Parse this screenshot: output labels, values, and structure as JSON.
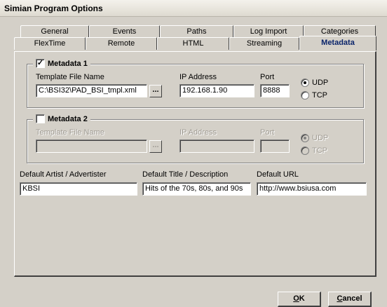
{
  "window": {
    "title": "Simian Program Options"
  },
  "tabs": {
    "row1": [
      "General",
      "Events",
      "Paths",
      "Log Import",
      "Categories"
    ],
    "row2": [
      "FlexTime",
      "Remote",
      "HTML",
      "Streaming",
      "Metadata"
    ],
    "active": "Metadata"
  },
  "metadata1": {
    "label": "Metadata 1",
    "checked": true,
    "check_glyph": "✓",
    "template_label": "Template File Name",
    "template_value": "C:\\BSI32\\PAD_BSI_tmpl.xml",
    "browse_label": "...",
    "ip_label": "IP Address",
    "ip_value": "192.168.1.90",
    "port_label": "Port",
    "port_value": "8888",
    "protocol_options": [
      "UDP",
      "TCP"
    ],
    "protocol_selected": "UDP"
  },
  "metadata2": {
    "label": "Metadata 2",
    "checked": false,
    "template_label": "Template File Name",
    "template_value": "",
    "browse_label": "...",
    "ip_label": "IP Address",
    "ip_value": "",
    "port_label": "Port",
    "port_value": "",
    "protocol_options": [
      "UDP",
      "TCP"
    ],
    "protocol_selected": "UDP"
  },
  "defaults": {
    "artist_label": "Default Artist / Advertister",
    "artist_value": "KBSI",
    "title_label": "Default Title / Description",
    "title_value": "Hits of the 70s, 80s, and 90s",
    "url_label": "Default URL",
    "url_value": "http://www.bsiusa.com"
  },
  "buttons": {
    "ok_mnemonic": "O",
    "ok_rest": "K",
    "cancel_mnemonic": "C",
    "cancel_rest": "ancel"
  }
}
